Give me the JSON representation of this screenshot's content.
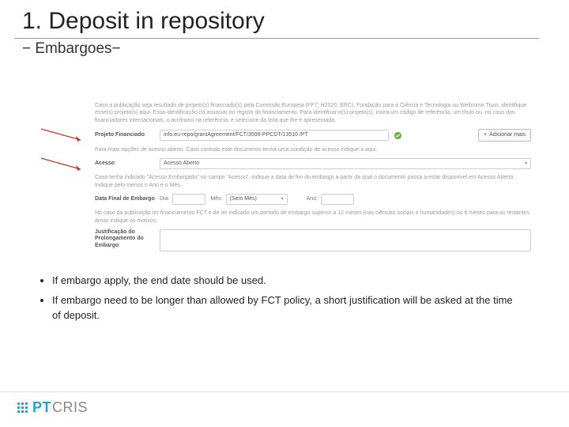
{
  "title": "1. Deposit in repository",
  "subtitle": "− Embargoes−",
  "form": {
    "help_project": "Caso a publicação seja resultado de projeto(s) financiado(s) pela Comissão Europeia (FP7, H2020, ERC), Fundação para a Ciência e Tecnologia ou Wellcome Trust, identifique esse(s) projeto(s) aqui. Essa identificação irá associar no registo do financiamento. Para identificar o(s) projeto(s), insira um código de referência, um título ou, no caso dos financiadores internacionais, o acrónimo na referência, e selecione da lista que lhe é apresentada.",
    "project_label": "Projeto Financiado",
    "project_value": "info:eu-repo/grantAgreement/FCT/3599-PPCDT/13510 /PT",
    "add_more": "Adicionar mais",
    "help_access": "Para mais opções de acesso aberto. Caso contudo este documento tenha uma condição de acesso indique-a aqui.",
    "access_label": "Acesso",
    "access_value": "Acesso Aberto",
    "help_embargo": "Caso tenha indicado \"Acesso Embargado\" no campo \"Acesso\", indique a data de fim do embargo a partir da qual o documento passa a estar disponível em Acesso Aberto. Indique pelo menos o Ano e o Mês.",
    "date_label": "Data Final de Embargo",
    "day_label": "Dia:",
    "month_label": "Mês:",
    "month_value": "(Sem Mês)",
    "year_label": "Ano:",
    "help_justification": "No caso da publicação ter financiamento FCT e de ter indicado um período de embargo superior a 12 meses (nas ciências sociais e humanidades) ou 6 meses para as restantes áreas indique os motivos.",
    "justification_label": "Justificação do Prolongamento do Embargo"
  },
  "bullets": [
    "If embargo apply, the end date should be used.",
    "If embargo need to be longer than allowed by FCT policy, a short justification will be asked at the time of deposit."
  ],
  "logo": {
    "pt": "PT",
    "cris": "CRIS"
  }
}
